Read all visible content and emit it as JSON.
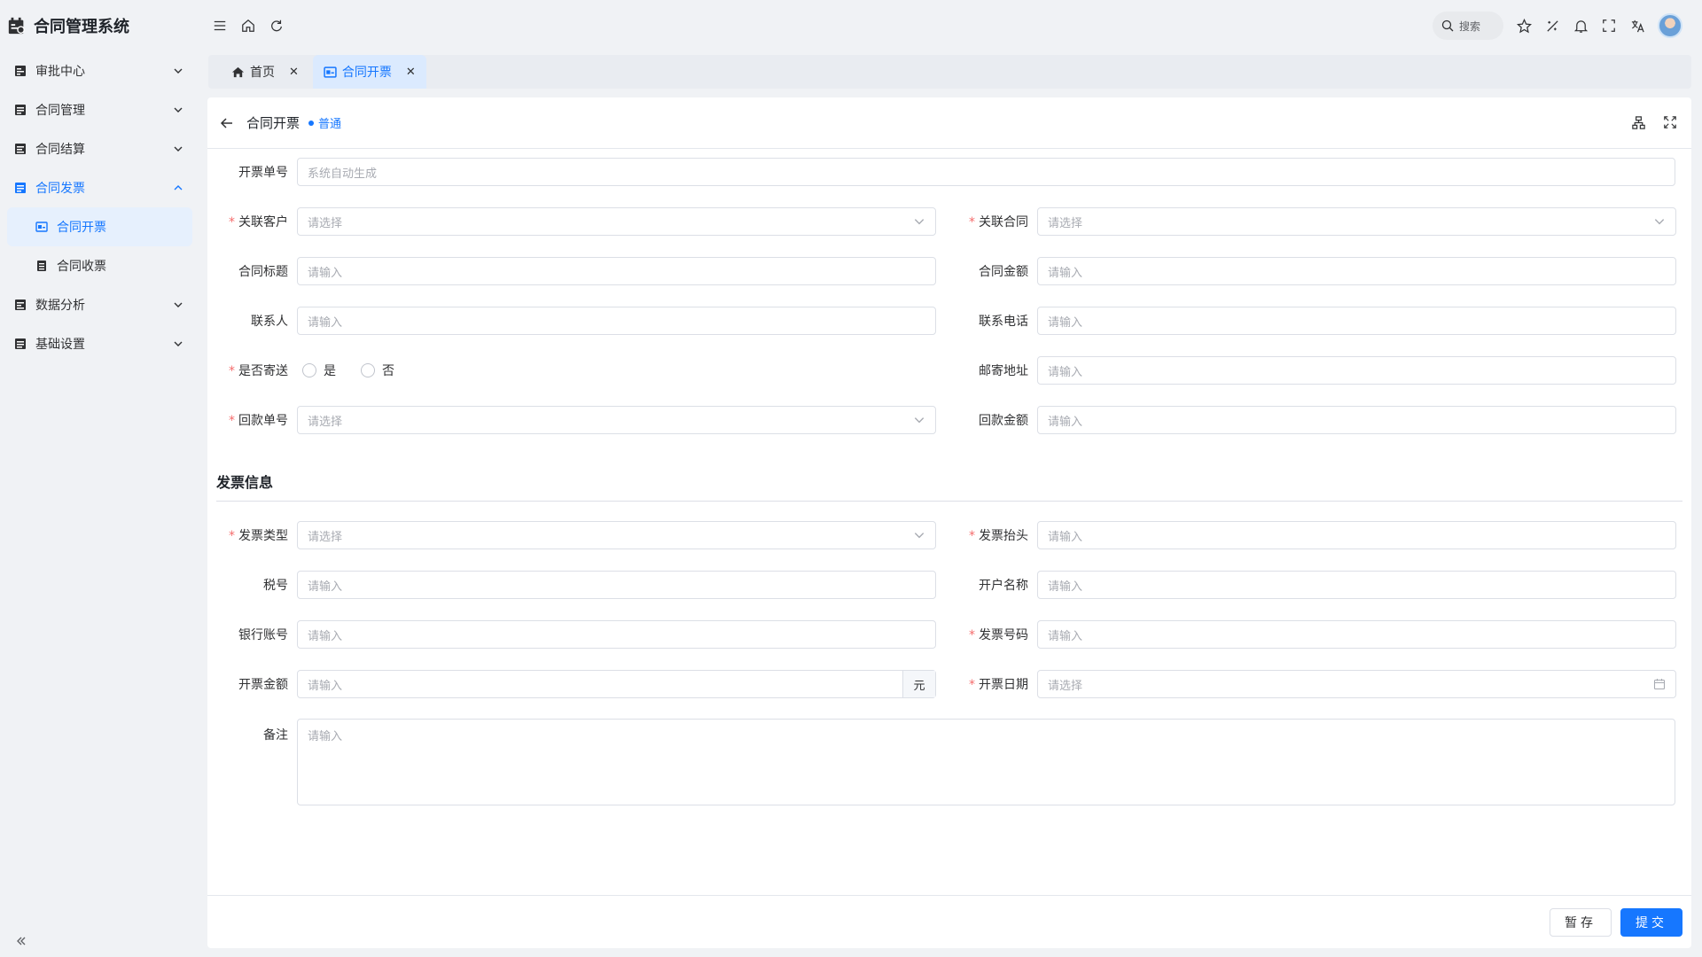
{
  "app": {
    "title": "合同管理系统"
  },
  "sidebar": {
    "items": [
      {
        "label": "审批中心",
        "icon": "approval-icon",
        "expanded": false
      },
      {
        "label": "合同管理",
        "icon": "contract-icon",
        "expanded": false
      },
      {
        "label": "合同结算",
        "icon": "settlement-icon",
        "expanded": false
      },
      {
        "label": "合同发票",
        "icon": "invoice-icon",
        "expanded": true,
        "active": true,
        "children": [
          {
            "label": "合同开票",
            "active": true
          },
          {
            "label": "合同收票",
            "active": false
          }
        ]
      },
      {
        "label": "数据分析",
        "icon": "analytics-icon",
        "expanded": false
      },
      {
        "label": "基础设置",
        "icon": "settings-icon",
        "expanded": false
      }
    ]
  },
  "header": {
    "search_placeholder": "搜索"
  },
  "tabs": [
    {
      "label": "首页",
      "active": false
    },
    {
      "label": "合同开票",
      "active": true
    }
  ],
  "page": {
    "title": "合同开票",
    "tag": "普通"
  },
  "form": {
    "invoice_no": {
      "label": "开票单号",
      "placeholder": "系统自动生成"
    },
    "customer": {
      "label": "关联客户",
      "placeholder": "请选择",
      "required": true
    },
    "contract": {
      "label": "关联合同",
      "placeholder": "请选择",
      "required": true
    },
    "contract_title": {
      "label": "合同标题",
      "placeholder": "请输入"
    },
    "contract_amount": {
      "label": "合同金额",
      "placeholder": "请输入"
    },
    "contact": {
      "label": "联系人",
      "placeholder": "请输入"
    },
    "phone": {
      "label": "联系电话",
      "placeholder": "请输入"
    },
    "mail": {
      "label": "是否寄送",
      "required": true,
      "options": [
        "是",
        "否"
      ]
    },
    "address": {
      "label": "邮寄地址",
      "placeholder": "请输入"
    },
    "payment_no": {
      "label": "回款单号",
      "placeholder": "请选择",
      "required": true
    },
    "payment_amount": {
      "label": "回款金额",
      "placeholder": "请输入"
    }
  },
  "invoice_section": {
    "title": "发票信息",
    "type": {
      "label": "发票类型",
      "placeholder": "请选择",
      "required": true
    },
    "header": {
      "label": "发票抬头",
      "placeholder": "请输入",
      "required": true
    },
    "tax_no": {
      "label": "税号",
      "placeholder": "请输入"
    },
    "account_name": {
      "label": "开户名称",
      "placeholder": "请输入"
    },
    "bank_account": {
      "label": "银行账号",
      "placeholder": "请输入"
    },
    "invoice_number": {
      "label": "发票号码",
      "placeholder": "请输入",
      "required": true
    },
    "amount": {
      "label": "开票金额",
      "placeholder": "请输入",
      "unit": "元"
    },
    "date": {
      "label": "开票日期",
      "placeholder": "请选择",
      "required": true
    },
    "remark": {
      "label": "备注",
      "placeholder": "请输入"
    }
  },
  "footer": {
    "save_label": "暂存",
    "submit_label": "提交"
  },
  "colors": {
    "primary": "#1677ff",
    "required": "#f56c6c"
  }
}
